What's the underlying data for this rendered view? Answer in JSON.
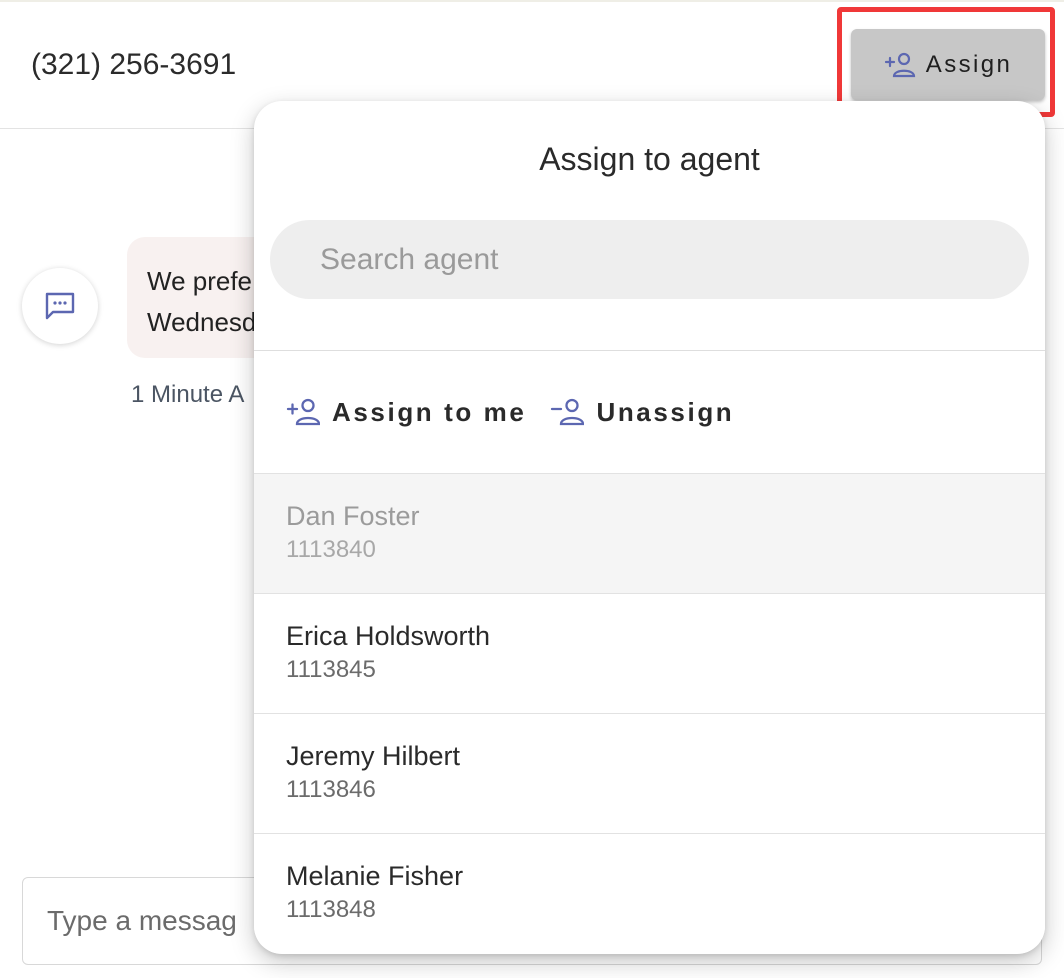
{
  "header": {
    "phone_number": "(321) 256-3691",
    "assign_button_label": "Assign"
  },
  "conversation": {
    "message_preview_line1": "We prefe",
    "message_preview_line2": "Wednesd",
    "timestamp": "1 Minute A",
    "composer_placeholder": "Type a messag"
  },
  "popup": {
    "title": "Assign to agent",
    "search_placeholder": "Search agent",
    "assign_to_me_label": "Assign to me",
    "unassign_label": "Unassign",
    "agents": [
      {
        "name": "Dan Foster",
        "id": "1113840",
        "current": true
      },
      {
        "name": "Erica Holdsworth",
        "id": "1113845",
        "current": false
      },
      {
        "name": "Jeremy Hilbert",
        "id": "1113846",
        "current": false
      },
      {
        "name": "Melanie Fisher",
        "id": "1113848",
        "current": false
      }
    ]
  },
  "colors": {
    "icon_accent": "#5c67b1",
    "highlight_border": "#f03838",
    "assign_button_bg": "#c7c7c7",
    "bubble_bg": "#f8f1f0"
  },
  "icons": {
    "assign": "person-add-icon",
    "unassign": "person-remove-icon",
    "message": "sms-icon"
  }
}
